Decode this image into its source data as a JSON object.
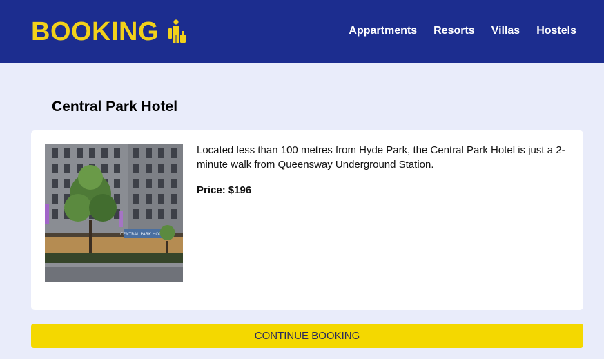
{
  "brand": {
    "name": "BOOKING",
    "icon": "traveler-luggage-icon",
    "color": "#f2d11a"
  },
  "nav": {
    "items": [
      {
        "label": "Appartments"
      },
      {
        "label": "Resorts"
      },
      {
        "label": "Villas"
      },
      {
        "label": "Hostels"
      }
    ]
  },
  "hotel": {
    "name": "Central Park Hotel",
    "description": "Located less than 100 metres from Hyde Park, the Central Park Hotel is just a 2-minute walk from Queensway Underground Station.",
    "price": "Price: $196",
    "image_sign": "CENTRAL PARK HOTEL"
  },
  "actions": {
    "continue_label": "CONTINUE BOOKING"
  },
  "colors": {
    "header": "#1c2d8f",
    "background": "#e9ecfa",
    "button": "#f4d800"
  }
}
